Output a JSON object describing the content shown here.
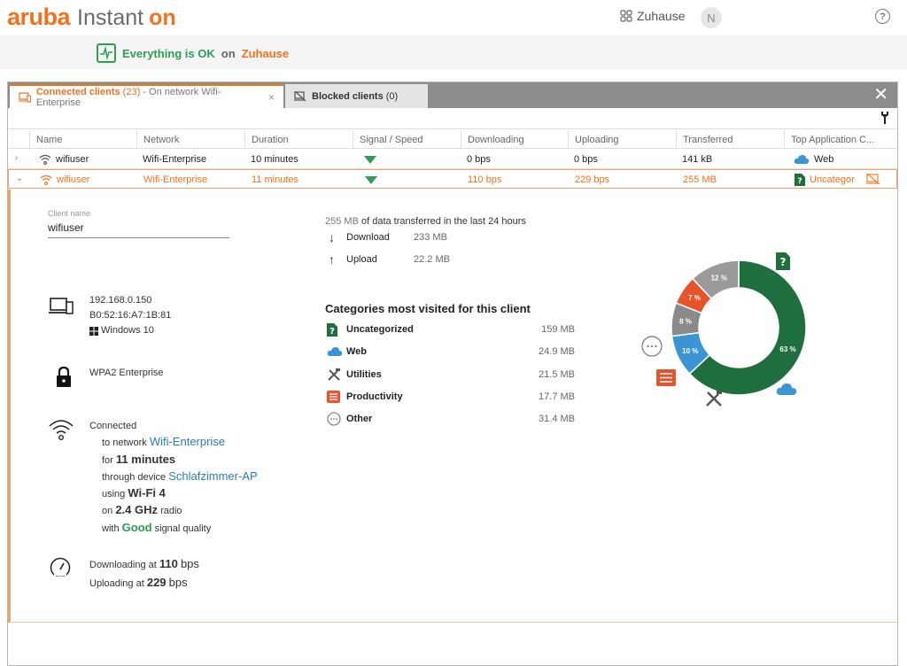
{
  "app": {
    "brand": "aruba",
    "product": "Instant",
    "product_suffix": "on"
  },
  "header": {
    "site": "Zuhause",
    "avatar_initial": "N",
    "help": "?"
  },
  "status": {
    "ok_text": "Everything is OK",
    "on": "on",
    "site": "Zuhause"
  },
  "tabs": {
    "connected": {
      "label": "Connected clients",
      "count": "(23)",
      "network_text": "- On network Wifi-Enterprise",
      "close": "×"
    },
    "blocked": {
      "label": "Blocked clients",
      "count": "(0)"
    }
  },
  "panel_close": "✕",
  "table": {
    "headers": [
      "Name",
      "Network",
      "Duration",
      "Signal / Speed",
      "Downloading",
      "Uploading",
      "Transferred",
      "Top Application C..."
    ],
    "rows": [
      {
        "name": "wifiuser",
        "network": "Wifi-Enterprise",
        "duration": "10 minutes",
        "downloading": "0 bps",
        "uploading": "0 bps",
        "transferred": "141 kB",
        "top_app": "Web"
      },
      {
        "name": "wifiuser",
        "network": "Wifi-Enterprise",
        "duration": "11 minutes",
        "downloading": "110 bps",
        "uploading": "229 bps",
        "transferred": "255 MB",
        "top_app": "Uncategor"
      }
    ]
  },
  "detail": {
    "client_name_label": "Client name",
    "client_name": "wifiuser",
    "ip": "192.168.0.150",
    "mac": "B0:52:16:A7:1B:81",
    "os": "Windows 10",
    "security": "WPA2 Enterprise",
    "connection": {
      "status": "Connected",
      "to_network_prefix": "to network",
      "network": "Wifi-Enterprise",
      "for_prefix": "for",
      "duration": "11 minutes",
      "through_prefix": "through device",
      "device": "Schlafzimmer-AP",
      "using_prefix": "using",
      "wifi": "Wi-Fi 4",
      "on_prefix": "on",
      "band": "2.4 GHz",
      "radio_suffix": "radio",
      "with_prefix": "with",
      "quality": "Good",
      "quality_suffix": "signal quality"
    },
    "speed": {
      "down_prefix": "Downloading at",
      "down_value": "110",
      "down_unit": "bps",
      "up_prefix": "Uploading at",
      "up_value": "229",
      "up_unit": "bps"
    },
    "traffic": {
      "total": "255 MB",
      "total_suffix": "of data transferred in the last 24 hours",
      "download_label": "Download",
      "download_value": "233 MB",
      "upload_label": "Upload",
      "upload_value": "22.2 MB"
    },
    "categories_title": "Categories most visited for this client",
    "categories": [
      {
        "name": "Uncategorized",
        "value": "159 MB",
        "icon": "uncategorized-icon",
        "color": "#1e6e3e"
      },
      {
        "name": "Web",
        "value": "24.9 MB",
        "icon": "cloud-icon",
        "color": "#3a95d4"
      },
      {
        "name": "Utilities",
        "value": "21.5 MB",
        "icon": "tools-icon",
        "color": "#8a8a8a"
      },
      {
        "name": "Productivity",
        "value": "17.7 MB",
        "icon": "productivity-icon",
        "color": "#e8542a"
      },
      {
        "name": "Other",
        "value": "31.4 MB",
        "icon": "more-icon",
        "color": "#9a9a9a"
      }
    ]
  },
  "chart_data": {
    "type": "pie",
    "slices": [
      {
        "label": "63 %",
        "value": 63,
        "color": "#1e6e3e"
      },
      {
        "label": "10 %",
        "value": 10,
        "color": "#3a95d4"
      },
      {
        "label": "8 %",
        "value": 8,
        "color": "#8a8a8a"
      },
      {
        "label": "7 %",
        "value": 7,
        "color": "#e8542a"
      },
      {
        "label": "12 %",
        "value": 12,
        "color": "#9a9a9a"
      }
    ]
  },
  "colors": {
    "accent": "#f2711c",
    "ok": "#2e9e57",
    "link": "#2a7bbd"
  }
}
